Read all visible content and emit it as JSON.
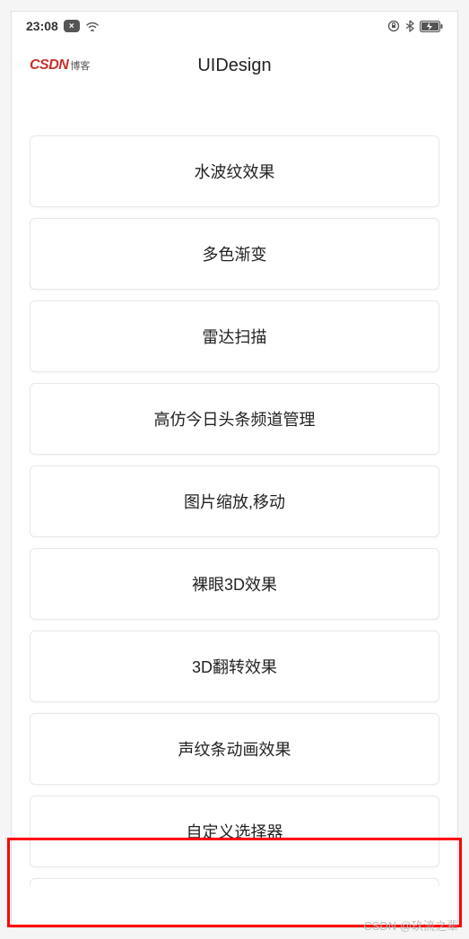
{
  "status_bar": {
    "time": "23:08",
    "close_badge": "×"
  },
  "header": {
    "logo_main": "CSDN",
    "logo_sub": "博客",
    "title": "UIDesign"
  },
  "list_items": [
    {
      "label": "水波纹效果"
    },
    {
      "label": "多色渐变"
    },
    {
      "label": "雷达扫描"
    },
    {
      "label": "高仿今日头条频道管理"
    },
    {
      "label": "图片缩放,移动"
    },
    {
      "label": "裸眼3D效果"
    },
    {
      "label": "3D翻转效果"
    },
    {
      "label": "声纹条动画效果"
    },
    {
      "label": "自定义选择器"
    }
  ],
  "watermark": "CSDN @玖流之辈"
}
